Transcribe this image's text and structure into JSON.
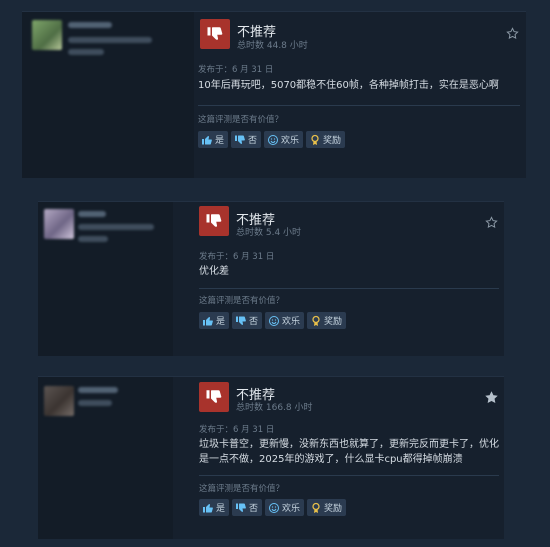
{
  "reviews": [
    {
      "verdict": "不推荐",
      "hours": "总时数 44.8 小时",
      "posted": "发布于：6 月 31 日",
      "text_lines": [
        "10年后再玩吧，5070都稳不住60帧，各种掉帧打击，实在是恶心啊"
      ],
      "helpful_prompt": "这篇评测是否有价值？",
      "buttons": {
        "yes": "是",
        "no": "否",
        "funny": "欢乐",
        "award": "奖励"
      },
      "favorite_filled": false
    },
    {
      "verdict": "不推荐",
      "hours": "总时数 5.4 小时",
      "posted": "发布于：6 月 31 日",
      "text_lines": [
        "优化差"
      ],
      "helpful_prompt": "这篇评测是否有价值？",
      "buttons": {
        "yes": "是",
        "no": "否",
        "funny": "欢乐",
        "award": "奖励"
      },
      "favorite_filled": false
    },
    {
      "verdict": "不推荐",
      "hours": "总时数 166.8 小时",
      "posted": "发布于：6 月 31 日",
      "text_lines": [
        "垃圾卡普空，更新慢，没新东西也就算了，更新完反而更卡了，优化",
        "是一点不做，2025年的游戏了，什么显卡cpu都得掉帧崩溃"
      ],
      "helpful_prompt": "这篇评测是否有价值？",
      "buttons": {
        "yes": "是",
        "no": "否",
        "funny": "欢乐",
        "award": "奖励"
      },
      "favorite_filled": true
    }
  ],
  "colors": {
    "thumb_down_bg": "#a8332c",
    "button_bg": "#2b3b50",
    "card_bg": "#16202d",
    "page_bg": "#1b2838"
  }
}
